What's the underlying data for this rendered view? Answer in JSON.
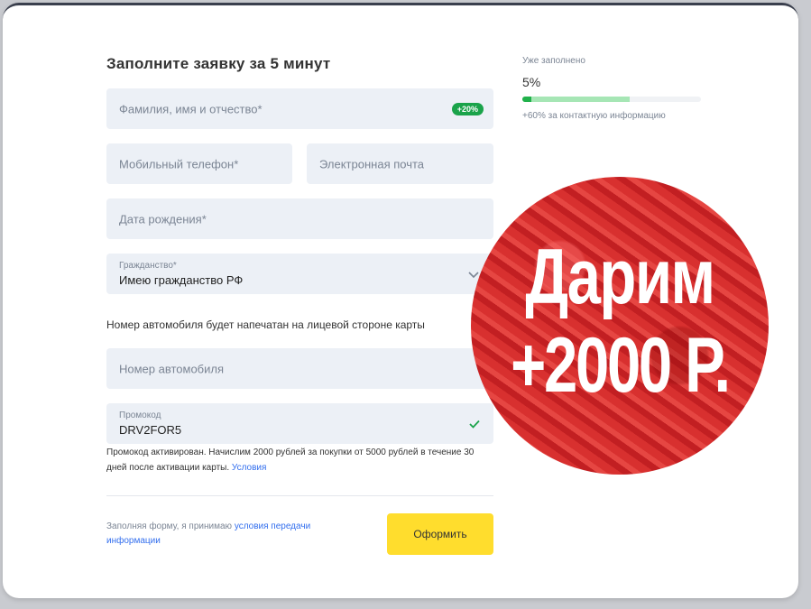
{
  "form": {
    "title": "Заполните заявку за 5 минут",
    "full_name": {
      "placeholder": "Фамилия, имя и отчество*",
      "badge": "+20%"
    },
    "phone": {
      "placeholder": "Мобильный телефон*"
    },
    "email": {
      "placeholder": "Электронная почта"
    },
    "birthdate": {
      "placeholder": "Дата рождения*"
    },
    "citizenship": {
      "label": "Гражданство*",
      "value": "Имею гражданство РФ"
    },
    "car_note": "Номер автомобиля будет напечатан на лицевой стороне карты",
    "car_number": {
      "placeholder": "Номер автомобиля"
    },
    "promo": {
      "label": "Промокод",
      "value": "DRV2FOR5"
    },
    "promo_note": "Промокод активирован. Начислим 2000 рублей за покупки от 5000 рублей в течение 30 дней после активации карты.",
    "promo_terms_link": "Условия",
    "consent_text": "Заполняя форму, я принимаю",
    "consent_link": "условия передачи информации",
    "submit_label": "Оформить"
  },
  "progress": {
    "label": "Уже заполнено",
    "percent_text": "5%",
    "filled_fraction": 0.05,
    "potential_fraction": 0.6,
    "subtext": "+60% за контактную информацию"
  },
  "promo_banner": {
    "line1": "Дарим",
    "line2": "+2000 Р."
  },
  "colors": {
    "accent_yellow": "#ffdd2d",
    "success_green": "#1aa34a",
    "field_bg": "#ecf0f6",
    "banner_red": "#d4282a",
    "link_blue": "#336fee"
  }
}
